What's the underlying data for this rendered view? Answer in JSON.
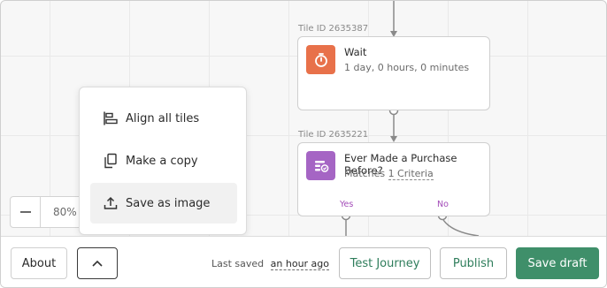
{
  "canvas": {
    "tile_wait": {
      "id_label": "Tile ID 2635387",
      "title": "Wait",
      "subtitle": "1 day, 0 hours, 0 minutes",
      "icon": "stopwatch-icon",
      "icon_color": "#e8714a"
    },
    "tile_condition": {
      "id_label": "Tile ID 2635221",
      "title": "Ever Made a Purchase Before?",
      "subtitle_prefix": "Matches",
      "criteria_link": "1 Criteria",
      "icon": "condition-icon",
      "icon_color": "#a565c4"
    },
    "branches": {
      "yes": "Yes",
      "no": "No"
    }
  },
  "zoom": {
    "value": "80%",
    "minus_icon": "minus-icon"
  },
  "menu": {
    "items": [
      {
        "label": "Align all tiles",
        "icon": "align-icon"
      },
      {
        "label": "Make a copy",
        "icon": "copy-icon"
      },
      {
        "label": "Save as image",
        "icon": "upload-icon"
      }
    ]
  },
  "footer": {
    "about_label": "About",
    "expand_icon": "chevron-up-icon",
    "last_saved_label": "Last saved",
    "last_saved_time": "an hour ago",
    "test_label": "Test Journey",
    "publish_label": "Publish",
    "save_label": "Save draft"
  },
  "colors": {
    "accent_green": "#3f8f6a",
    "branch_purple": "#a34bb8"
  }
}
